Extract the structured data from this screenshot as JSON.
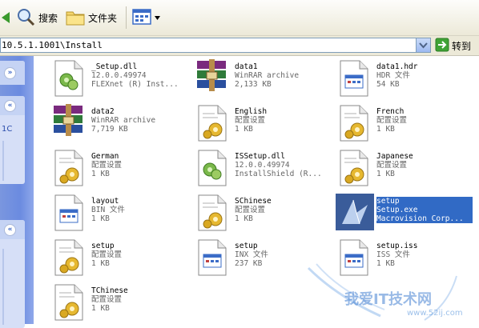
{
  "toolbar": {
    "search_label": "搜索",
    "folders_label": "文件夹"
  },
  "address": {
    "path": "10.5.1.1001\\Install",
    "go_label": "转到"
  },
  "left_pane": {
    "fragment": "1C"
  },
  "files": [
    {
      "name": "_Setup.dll",
      "line2": "12.0.0.49974",
      "line3": "FLEXnet (R) Inst...",
      "icon": "dll-icon",
      "selected": false
    },
    {
      "name": "data1",
      "line2": "WinRAR archive",
      "line3": "2,133 KB",
      "icon": "winrar-icon",
      "selected": false
    },
    {
      "name": "data1.hdr",
      "line2": "HDR 文件",
      "line3": "54 KB",
      "icon": "generic-file-icon",
      "selected": false
    },
    {
      "name": "data2",
      "line2": "WinRAR archive",
      "line3": "7,719 KB",
      "icon": "winrar-icon",
      "selected": false
    },
    {
      "name": "English",
      "line2": "配置设置",
      "line3": "1 KB",
      "icon": "config-icon",
      "selected": false
    },
    {
      "name": "French",
      "line2": "配置设置",
      "line3": "1 KB",
      "icon": "config-icon",
      "selected": false
    },
    {
      "name": "German",
      "line2": "配置设置",
      "line3": "1 KB",
      "icon": "config-icon",
      "selected": false
    },
    {
      "name": "ISSetup.dll",
      "line2": "12.0.0.49974",
      "line3": "InstallShield (R...",
      "icon": "dll-icon",
      "selected": false
    },
    {
      "name": "Japanese",
      "line2": "配置设置",
      "line3": "1 KB",
      "icon": "config-icon",
      "selected": false
    },
    {
      "name": "layout",
      "line2": "BIN 文件",
      "line3": "1 KB",
      "icon": "generic-file-icon",
      "selected": false
    },
    {
      "name": "SChinese",
      "line2": "配置设置",
      "line3": "1 KB",
      "icon": "config-icon",
      "selected": false
    },
    {
      "name": "setup",
      "line2": "Setup.exe",
      "line3": "Macrovision Corp...",
      "icon": "setup-exe-icon",
      "selected": true
    },
    {
      "name": "setup",
      "line2": "配置设置",
      "line3": "1 KB",
      "icon": "config-icon",
      "selected": false
    },
    {
      "name": "setup",
      "line2": "INX 文件",
      "line3": "237 KB",
      "icon": "generic-file-icon",
      "selected": false
    },
    {
      "name": "setup.iss",
      "line2": "ISS 文件",
      "line3": "1 KB",
      "icon": "generic-file-icon",
      "selected": false
    },
    {
      "name": "TChinese",
      "line2": "配置设置",
      "line3": "1 KB",
      "icon": "config-icon",
      "selected": false
    }
  ],
  "watermark": {
    "text": "我爱IT技术网",
    "url": "www.52ij.com"
  },
  "colors": {
    "selection": "#316ac5",
    "task_pane": "#6b8be0",
    "toolbar": "#ece9d8"
  }
}
